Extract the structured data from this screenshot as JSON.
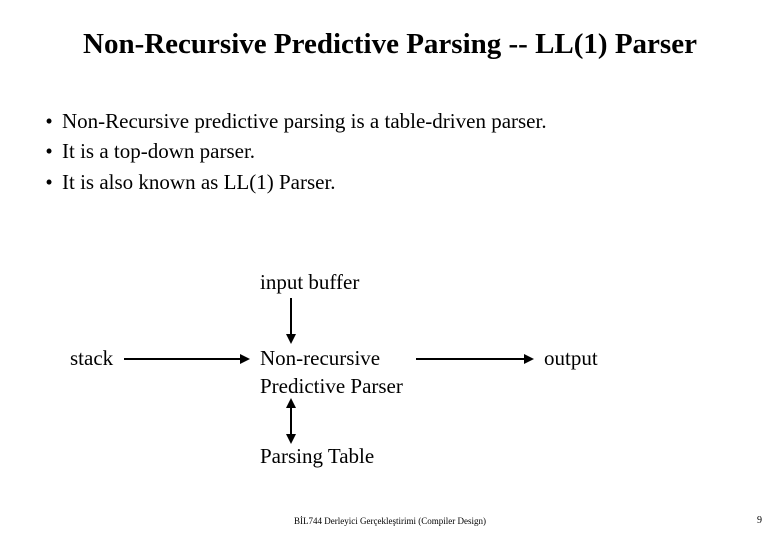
{
  "title": "Non-Recursive Predictive Parsing -- LL(1) Parser",
  "bullets": {
    "b0": "Non-Recursive predictive parsing is a table-driven parser.",
    "b1": "It is a top-down parser.",
    "b2": "It is also known as LL(1) Parser."
  },
  "diagram": {
    "input_buffer": "input buffer",
    "stack": "stack",
    "parser_line1": "Non-recursive",
    "parser_line2": "Predictive Parser",
    "output": "output",
    "table": "Parsing Table"
  },
  "footer": "BİL744 Derleyici Gerçekleştirimi (Compiler Design)",
  "page": "9"
}
